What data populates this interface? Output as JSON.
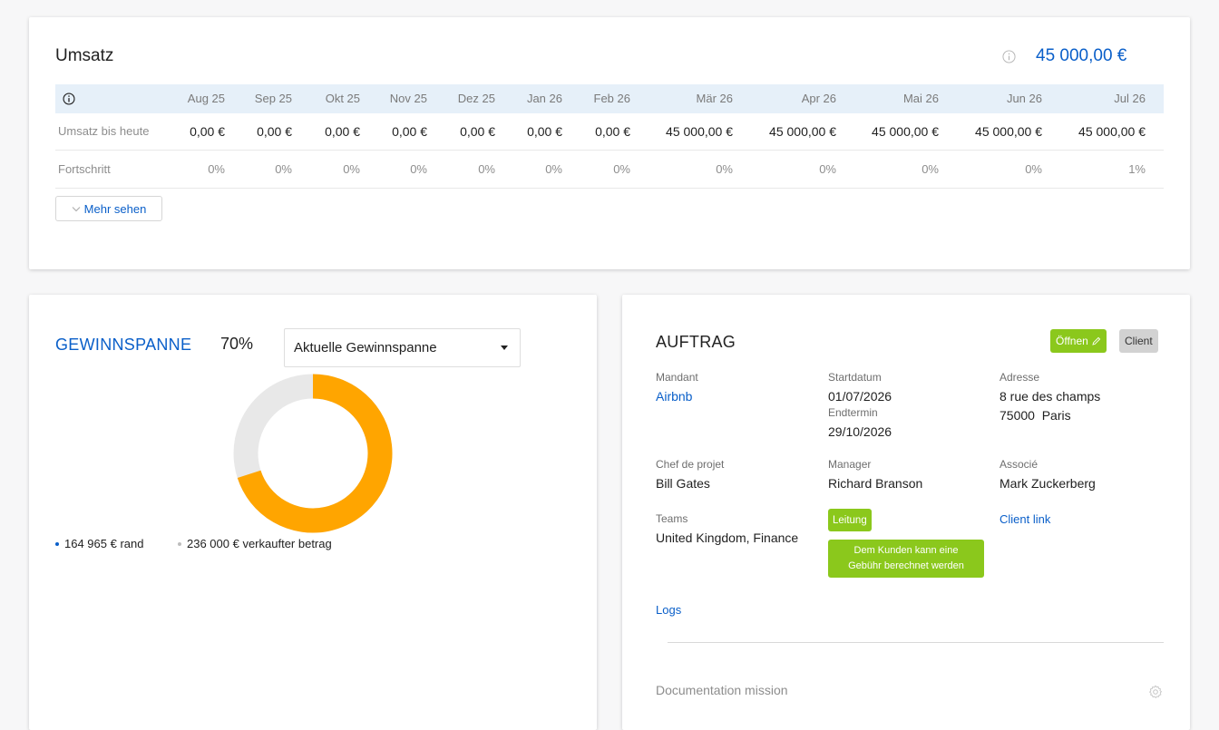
{
  "umsatz": {
    "title": "Umsatz",
    "total": "45 000,00 €",
    "months": [
      "Aug 25",
      "Sep 25",
      "Okt 25",
      "Nov 25",
      "Dez 25",
      "Jan 26",
      "Feb 26",
      "Mär 26",
      "Apr 26",
      "Mai 26",
      "Jun 26",
      "Jul 26"
    ],
    "rows": [
      {
        "label": "Umsatz bis heute",
        "values": [
          "0,00 €",
          "0,00 €",
          "0,00 €",
          "0,00 €",
          "0,00 €",
          "0,00 €",
          "0,00 €",
          "45 000,00 €",
          "45 000,00 €",
          "45 000,00 €",
          "45 000,00 €",
          "45 000,00 €"
        ]
      },
      {
        "label": "Fortschritt",
        "values": [
          "0%",
          "0%",
          "0%",
          "0%",
          "0%",
          "0%",
          "0%",
          "0%",
          "0%",
          "0%",
          "0%",
          "1%"
        ]
      }
    ],
    "more_label": "Mehr sehen"
  },
  "gewinn": {
    "title": "GEWINNSPANNE",
    "percent": "70%",
    "select_value": "Aktuelle Gewinnspanne",
    "legend": [
      {
        "label": "164 965 € rand",
        "color": "#0a5fc9"
      },
      {
        "label": "236 000 € verkaufter betrag",
        "color": "#bdbdbd"
      }
    ]
  },
  "chart_data": {
    "type": "pie",
    "labels": [
      "rand",
      "verkaufter betrag"
    ],
    "values": [
      164965,
      236000
    ],
    "donut_fraction_highlighted": 0.7,
    "colors": {
      "highlight": "#ffa500",
      "rest": "#e8e8e8"
    }
  },
  "auftrag": {
    "title": "AUFTRAG",
    "open_label": "Öffnen",
    "client_label": "Client",
    "mandant_label": "Mandant",
    "mandant": "Airbnb",
    "start_label": "Startdatum",
    "start": "01/07/2026",
    "end_label": "Endtermin",
    "end": "29/10/2026",
    "adresse_label": "Adresse",
    "adresse_1": "8 rue des champs",
    "adresse_2": "75000  Paris",
    "chef_label": "Chef de projet",
    "chef": "Bill Gates",
    "manager_label": "Manager",
    "manager": "Richard Branson",
    "associe_label": "Associé",
    "associe": "Mark Zuckerberg",
    "teams_label": "Teams",
    "teams": "United Kingdom, Finance",
    "leitung_badge": "Leitung",
    "fee_badge_1": "Dem Kunden kann eine",
    "fee_badge_2": "Gebühr berechnet werden",
    "client_link": "Client link",
    "logs": "Logs",
    "documentation": "Documentation mission"
  }
}
